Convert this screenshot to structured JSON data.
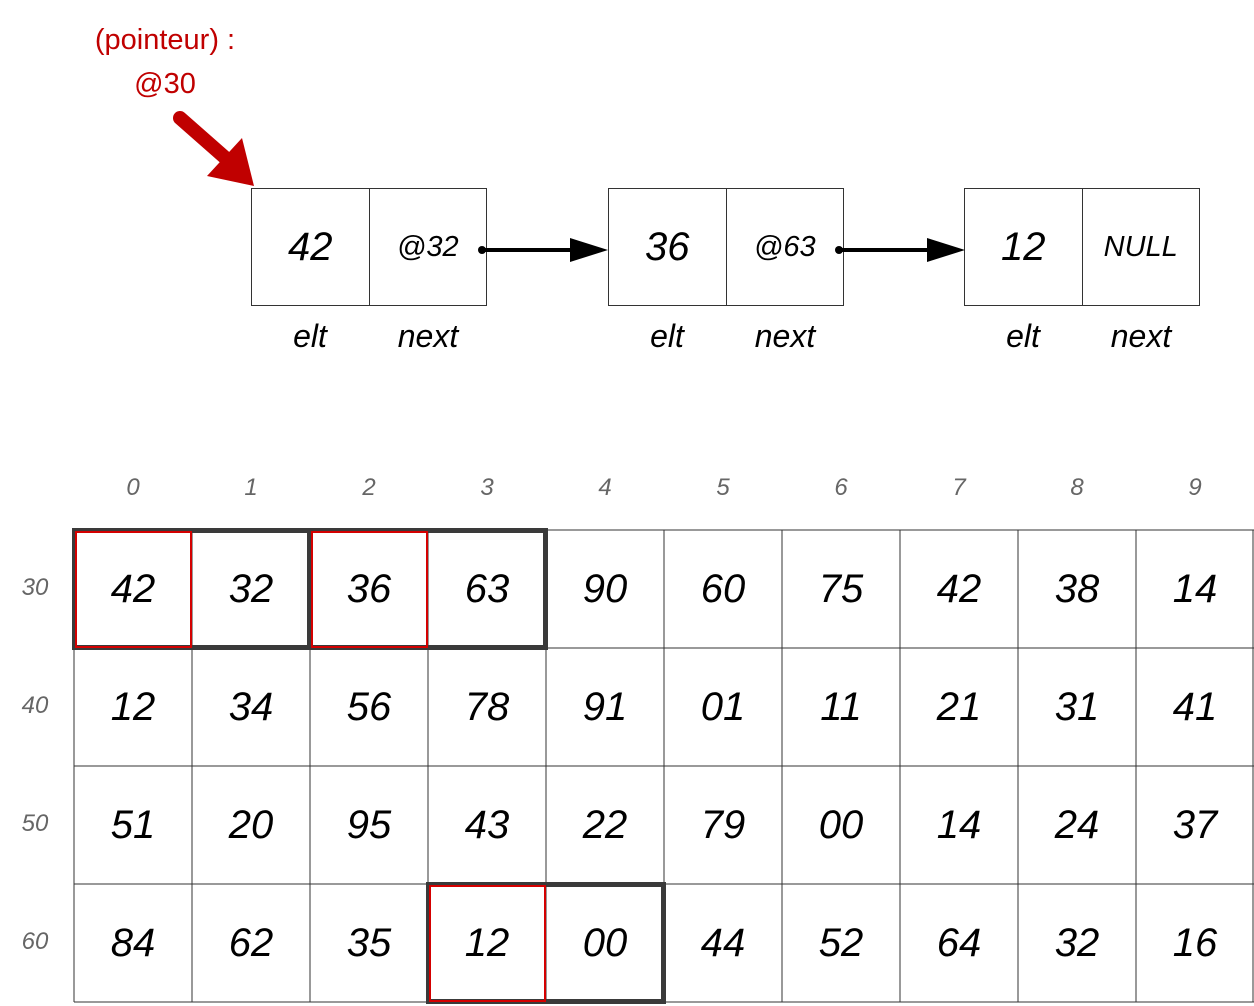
{
  "pointer": {
    "label_line1": "(pointeur) :",
    "label_line2": "@30",
    "color": "#c00000"
  },
  "linked_list": {
    "nodes": [
      {
        "elt": "42",
        "next": "@32"
      },
      {
        "elt": "36",
        "next": "@63"
      },
      {
        "elt": "12",
        "next": "NULL"
      }
    ],
    "field_labels": {
      "elt": "elt",
      "next": "next"
    }
  },
  "memory": {
    "column_headers": [
      "0",
      "1",
      "2",
      "3",
      "4",
      "5",
      "6",
      "7",
      "8",
      "9"
    ],
    "row_headers": [
      "30",
      "40",
      "50",
      "60"
    ],
    "rows": [
      [
        "42",
        "32",
        "36",
        "63",
        "90",
        "60",
        "75",
        "42",
        "38",
        "14"
      ],
      [
        "12",
        "34",
        "56",
        "78",
        "91",
        "01",
        "11",
        "21",
        "31",
        "41"
      ],
      [
        "51",
        "20",
        "95",
        "43",
        "22",
        "79",
        "00",
        "14",
        "24",
        "37"
      ],
      [
        "84",
        "62",
        "35",
        "12",
        "00",
        "44",
        "52",
        "64",
        "32",
        "16"
      ]
    ],
    "highlights": [
      {
        "address": "30",
        "elt_cell": "42",
        "next_cell": "32"
      },
      {
        "address": "32",
        "elt_cell": "36",
        "next_cell": "63"
      },
      {
        "address": "63",
        "elt_cell": "12",
        "next_cell": "00"
      }
    ],
    "colors": {
      "node_outline": "#3a3a3a",
      "elt_outline": "#d40000"
    }
  }
}
